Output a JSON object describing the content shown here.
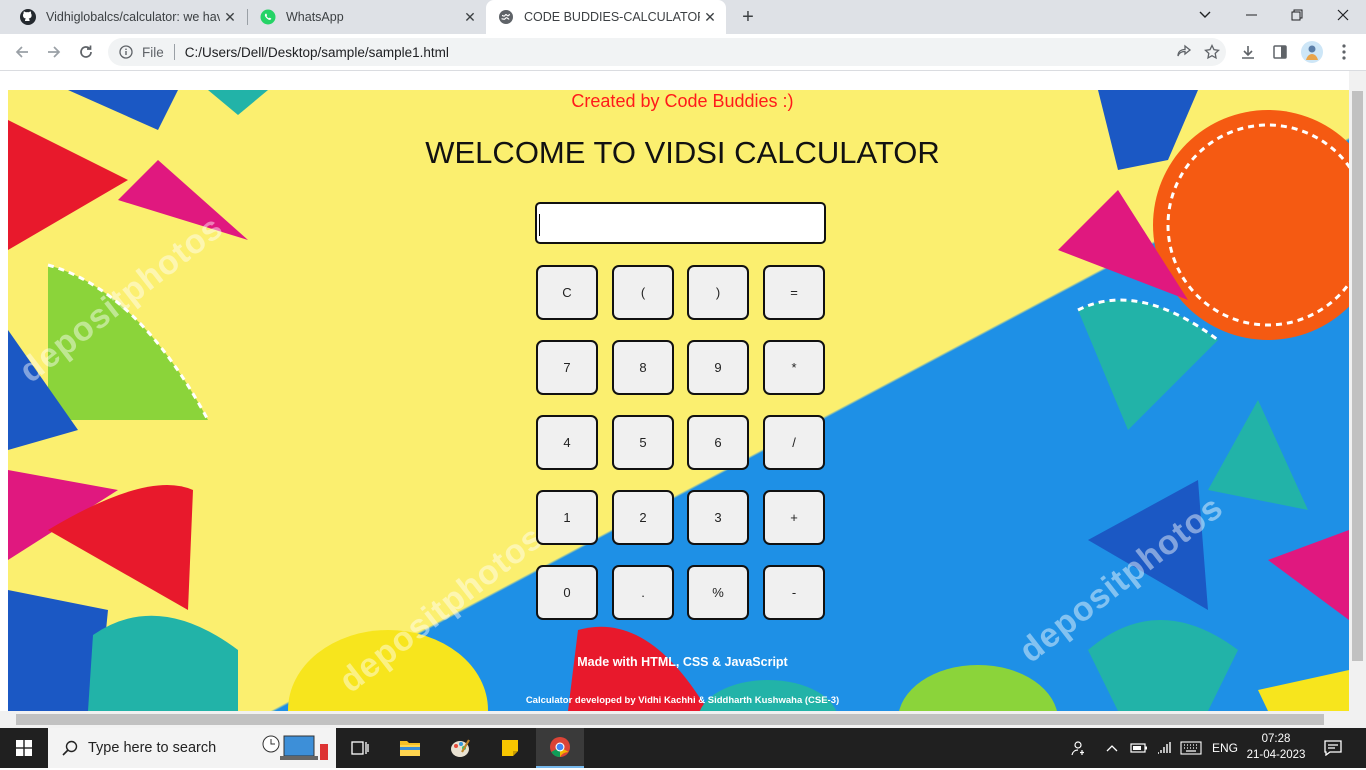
{
  "browser": {
    "tabs": [
      {
        "title": "Vidhiglobalcs/calculator: we have",
        "icon": "github-icon",
        "active": false
      },
      {
        "title": "WhatsApp",
        "icon": "whatsapp-icon",
        "active": false
      },
      {
        "title": "CODE BUDDIES-CALCULATOR",
        "icon": "globe-icon",
        "active": true
      }
    ],
    "address": {
      "scheme_label": "File",
      "url": "C:/Users/Dell/Desktop/sample/sample1.html"
    }
  },
  "page": {
    "created_by": "Created by Code Buddies :)",
    "heading": "WELCOME TO VIDSI CALCULATOR",
    "display_value": "",
    "keys": [
      [
        "C",
        "(",
        ")",
        "="
      ],
      [
        "7",
        "8",
        "9",
        "*"
      ],
      [
        "4",
        "5",
        "6",
        "/"
      ],
      [
        "1",
        "2",
        "3",
        "+"
      ],
      [
        "0",
        ".",
        "%",
        "-"
      ]
    ],
    "made_with": "Made with HTML, CSS & JavaScript",
    "developed_by": "Calculator developed by Vidhi Kachhi & Siddharth Kushwaha (CSE-3)",
    "background_watermark": "depositphotos",
    "colors": {
      "yellow_bg": "#fbef6f",
      "blue_bg": "#1e90e6",
      "created_text": "#ff1a1a"
    }
  },
  "taskbar": {
    "search_placeholder": "Type here to search",
    "language": "ENG",
    "time": "07:28",
    "date": "21-04-2023"
  }
}
